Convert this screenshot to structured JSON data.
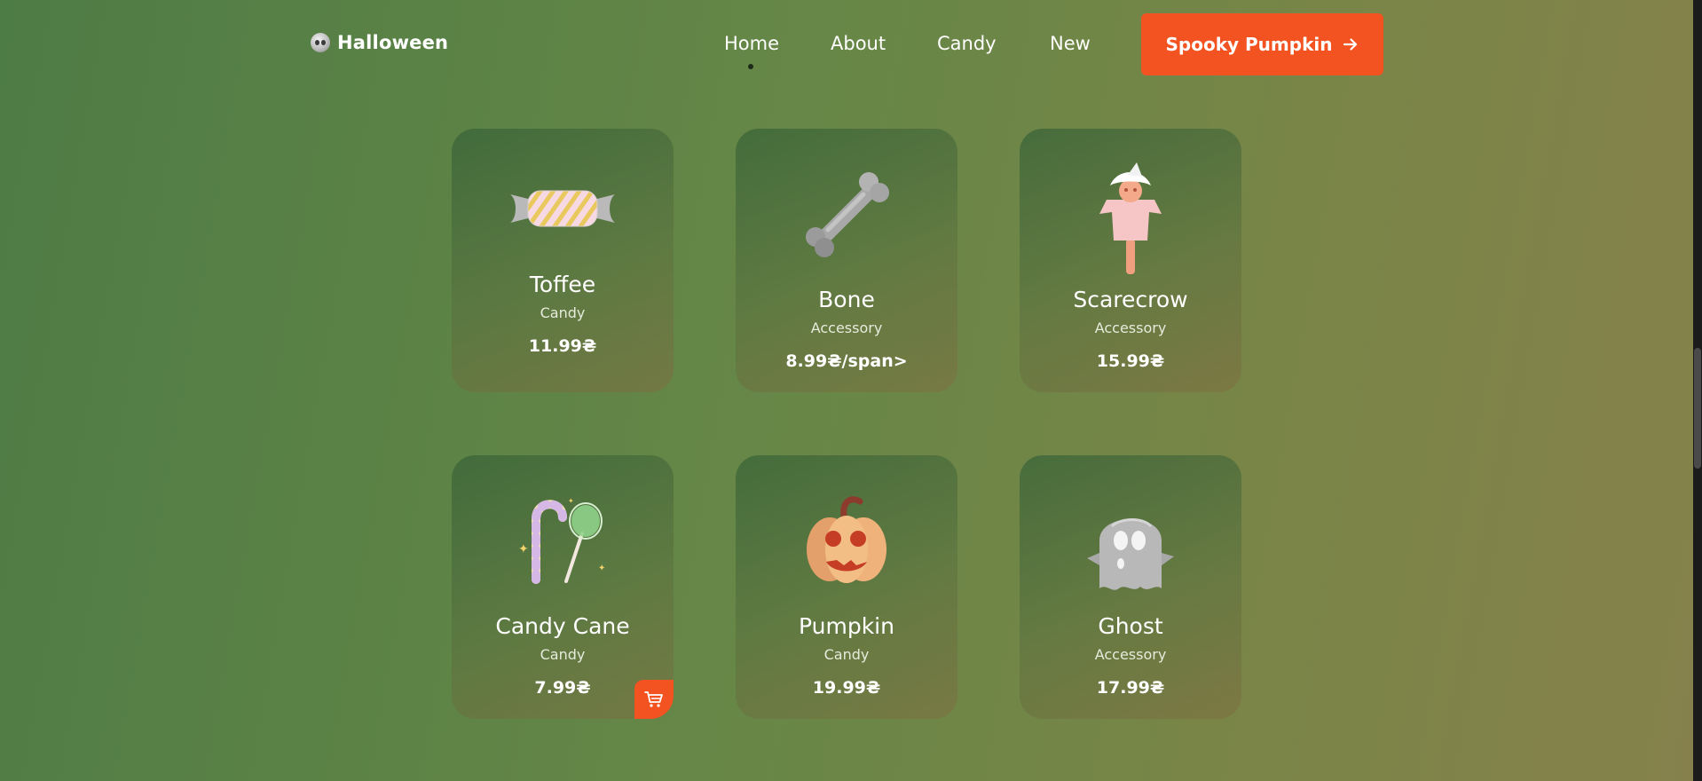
{
  "header": {
    "logo_text": "Halloween",
    "nav": [
      {
        "label": "Home",
        "active": true
      },
      {
        "label": "About"
      },
      {
        "label": "Candy"
      },
      {
        "label": "New"
      }
    ],
    "cta_label": "Spooky Pumpkin"
  },
  "products": [
    {
      "name": "Toffee",
      "category": "Candy",
      "price": "11.99₴",
      "icon": "toffee-icon"
    },
    {
      "name": "Bone",
      "category": "Accessory",
      "price": "8.99₴/span>",
      "icon": "bone-icon"
    },
    {
      "name": "Scarecrow",
      "category": "Accessory",
      "price": "15.99₴",
      "icon": "scarecrow-icon"
    },
    {
      "name": "Candy Cane",
      "category": "Candy",
      "price": "7.99₴",
      "icon": "candy-cane-icon"
    },
    {
      "name": "Pumpkin",
      "category": "Candy",
      "price": "19.99₴",
      "icon": "pumpkin-icon"
    },
    {
      "name": "Ghost",
      "category": "Accessory",
      "price": "17.99₴",
      "icon": "ghost-icon"
    }
  ],
  "colors": {
    "accent": "#f35321",
    "bg_left": "#4e7c45",
    "bg_right": "#86814c"
  }
}
